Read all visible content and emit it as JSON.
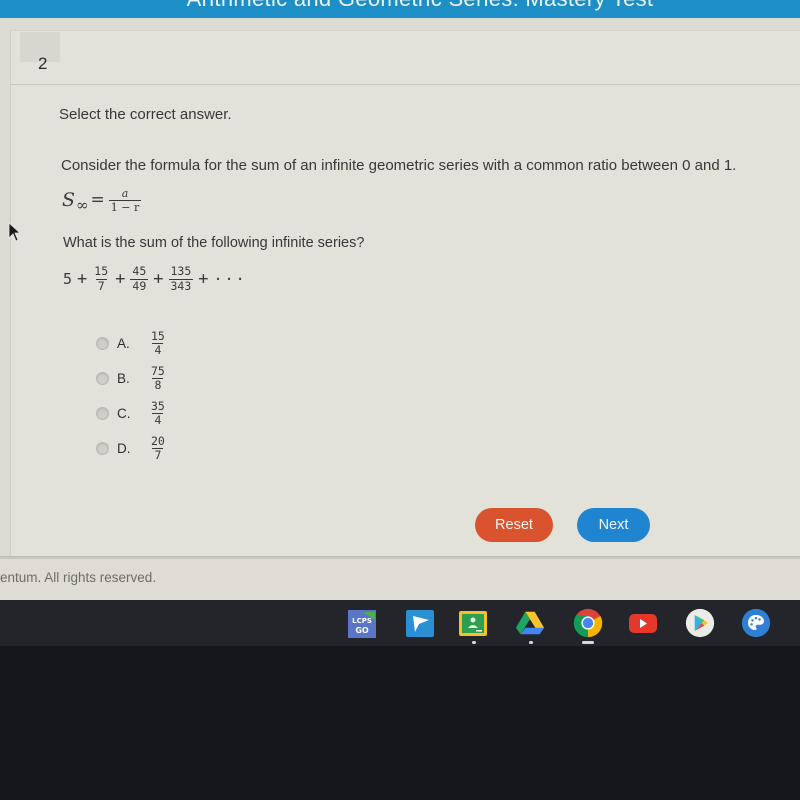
{
  "app": {
    "title": "Arithmetic and Geometric Series: Mastery Test"
  },
  "question": {
    "number": "2",
    "instruction": "Select the correct answer.",
    "prompt": "Consider the formula for the sum of an infinite geometric series with a common ratio between 0 and 1.",
    "formula": {
      "lhs": "S",
      "subscript": "∞",
      "equals": "=",
      "numerator": "a",
      "denominator": "1 − r"
    },
    "question_text": "What is the sum of the following infinite series?",
    "series": {
      "first_term": "5",
      "plus": "+",
      "terms": [
        {
          "num": "15",
          "den": "7"
        },
        {
          "num": "45",
          "den": "49"
        },
        {
          "num": "135",
          "den": "343"
        }
      ],
      "ellipsis": "···"
    },
    "options": [
      {
        "letter": "A.",
        "num": "15",
        "den": "4",
        "selected": false
      },
      {
        "letter": "B.",
        "num": "75",
        "den": "8",
        "selected": false
      },
      {
        "letter": "C.",
        "num": "35",
        "den": "4",
        "selected": false
      },
      {
        "letter": "D.",
        "num": "20",
        "den": "7",
        "selected": false
      }
    ]
  },
  "buttons": {
    "reset": "Reset",
    "next": "Next"
  },
  "colors": {
    "header": "#1d8fc6",
    "reset": "#d9532f",
    "next": "#2085d0"
  },
  "footer": {
    "copyright": "entum. All rights reserved."
  },
  "shelf": {
    "apps": [
      {
        "name": "lcps-go",
        "label": "LCPS GO"
      },
      {
        "name": "pear-deck",
        "label": ""
      },
      {
        "name": "google-classroom",
        "label": ""
      },
      {
        "name": "google-drive",
        "label": ""
      },
      {
        "name": "chrome",
        "label": ""
      },
      {
        "name": "youtube",
        "label": ""
      },
      {
        "name": "google-play",
        "label": ""
      },
      {
        "name": "palette",
        "label": ""
      }
    ]
  }
}
